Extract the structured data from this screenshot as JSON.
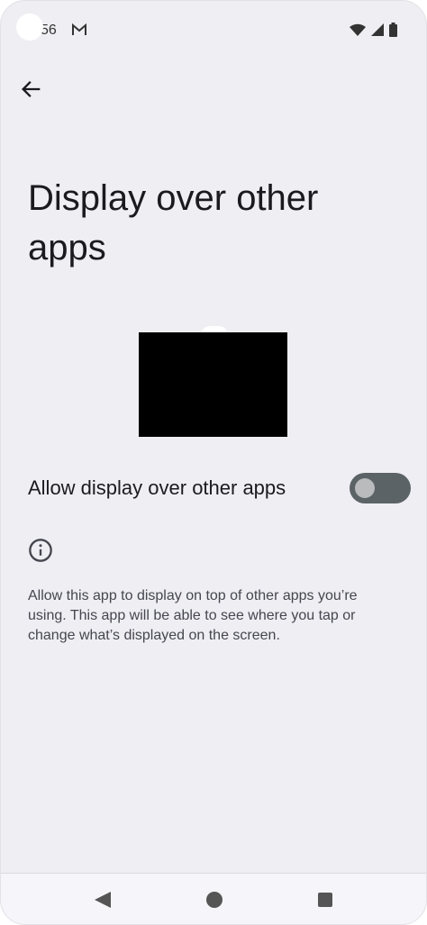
{
  "status_bar": {
    "time": "56"
  },
  "page": {
    "title": "Display over other apps",
    "allow_label": "Allow display over other apps",
    "toggle_state": "off",
    "description": "Allow this app to display on top of other apps you’re using. This app will be able to see where you tap or change what’s displayed on the screen."
  },
  "icons": {
    "back": "arrow-back-icon",
    "info": "info-icon",
    "gmail": "gmail-icon",
    "wifi": "wifi-icon",
    "signal": "signal-icon",
    "battery": "battery-icon"
  },
  "nav": {
    "back": "nav-back",
    "home": "nav-home",
    "recents": "nav-recents"
  },
  "colors": {
    "background": "#efeef3",
    "toggle_track": "#5c6366",
    "toggle_knob": "#b9bbbd"
  }
}
